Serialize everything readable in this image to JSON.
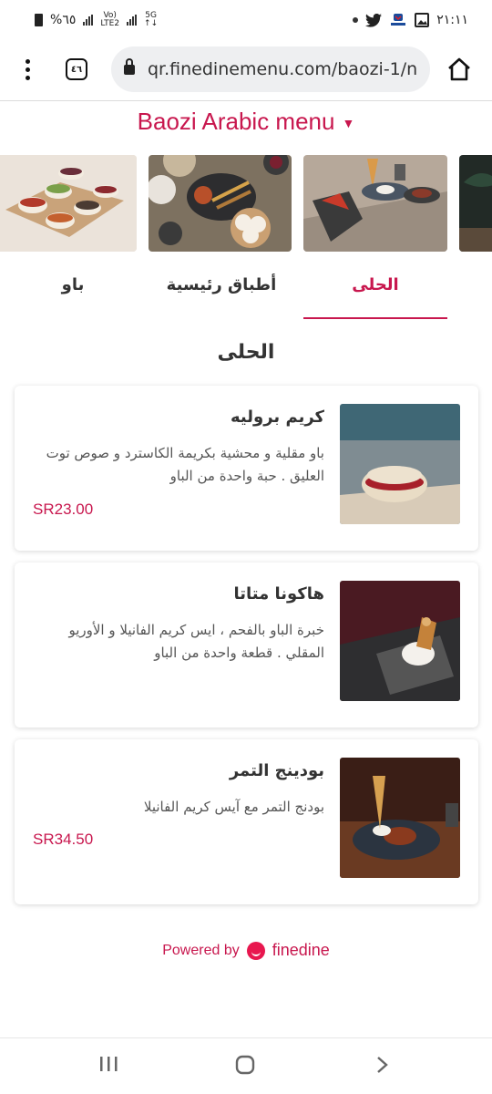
{
  "status_bar": {
    "battery_text": "%٦٥",
    "network_top": "Vo)",
    "network_bottom": "LTE2",
    "signal_label_top": "5G",
    "signal_label_bottom": "↑↓",
    "time": "٢١:١١",
    "icons": [
      "battery-icon",
      "signal-icon",
      "dot-icon",
      "twitter-icon",
      "carrefour-icon",
      "gallery-icon"
    ]
  },
  "browser": {
    "tab_count": "٤٦",
    "url": "qr.finedinemenu.com/baozi-1/n"
  },
  "menu_title": "Baozi Arabic menu",
  "category_tabs": [
    {
      "label": "الحلى",
      "active": true
    },
    {
      "label": "أطباق رئيسية",
      "active": false
    },
    {
      "label": "باو",
      "active": false
    }
  ],
  "section_title": "الحلى",
  "items": [
    {
      "name": "كريم بروليه",
      "description": "باو مقلية و محشية بكريمة الكاسترد و صوص توت العليق . حبة واحدة من الباو",
      "price": "SR23.00"
    },
    {
      "name": "هاكونا متاتا",
      "description": "خبرة الباو بالفحم ، ايس كريم الفانيلا و الأوريو المقلي . قطعة واحدة من الباو",
      "price": ""
    },
    {
      "name": "بودينج التمر",
      "description": "بودنج التمر مع آيس كريم الفانيلا",
      "price": "SR34.50"
    }
  ],
  "footer": {
    "powered_by": "Powered by",
    "brand": "finedine"
  },
  "colors": {
    "accent": "#c8174e",
    "brand": "#e8174f"
  }
}
